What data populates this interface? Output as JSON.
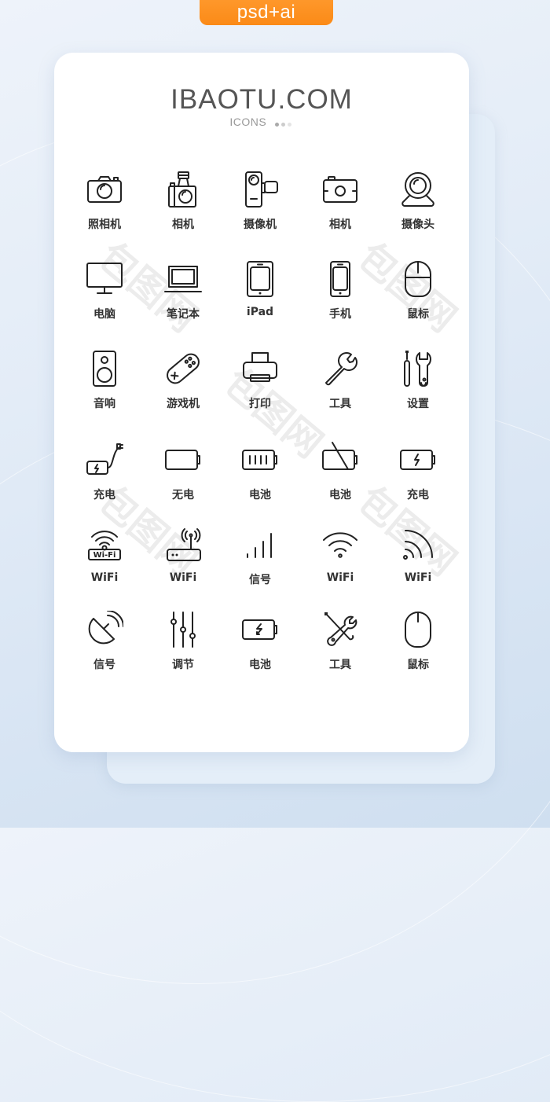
{
  "badge": {
    "label": "psd+ai",
    "color": "#fb8a17"
  },
  "header": {
    "title": "IBAOTU.COM",
    "subtitle": "ICONS"
  },
  "watermark": {
    "text": "包图网"
  },
  "icons": [
    {
      "name": "camera-icon",
      "label": "照相机"
    },
    {
      "name": "flash-camera-icon",
      "label": "相机"
    },
    {
      "name": "camcorder-icon",
      "label": "摄像机"
    },
    {
      "name": "compact-camera-icon",
      "label": "相机"
    },
    {
      "name": "webcam-icon",
      "label": "摄像头"
    },
    {
      "name": "monitor-icon",
      "label": "电脑"
    },
    {
      "name": "laptop-icon",
      "label": "笔记本"
    },
    {
      "name": "tablet-icon",
      "label": "iPad"
    },
    {
      "name": "phone-icon",
      "label": "手机"
    },
    {
      "name": "mouse-icon",
      "label": "鼠标"
    },
    {
      "name": "speaker-icon",
      "label": "音响"
    },
    {
      "name": "gamepad-icon",
      "label": "游戏机"
    },
    {
      "name": "printer-icon",
      "label": "打印"
    },
    {
      "name": "wrench-icon",
      "label": "工具"
    },
    {
      "name": "screwdriver-wrench-icon",
      "label": "设置"
    },
    {
      "name": "charger-battery-icon",
      "label": "充电"
    },
    {
      "name": "empty-battery-icon",
      "label": "无电"
    },
    {
      "name": "full-battery-icon",
      "label": "电池"
    },
    {
      "name": "no-battery-icon",
      "label": "电池"
    },
    {
      "name": "charging-battery-icon",
      "label": "充电"
    },
    {
      "name": "wifi-sign-icon",
      "label": "WiFi"
    },
    {
      "name": "router-icon",
      "label": "WiFi"
    },
    {
      "name": "signal-bars-icon",
      "label": "信号"
    },
    {
      "name": "wifi-icon",
      "label": "WiFi"
    },
    {
      "name": "wifi-corner-icon",
      "label": "WiFi"
    },
    {
      "name": "satellite-dish-icon",
      "label": "信号"
    },
    {
      "name": "sliders-icon",
      "label": "调节"
    },
    {
      "name": "battery-bolt-icon",
      "label": "电池"
    },
    {
      "name": "tools-icon",
      "label": "工具"
    },
    {
      "name": "mouse-simple-icon",
      "label": "鼠标"
    }
  ]
}
